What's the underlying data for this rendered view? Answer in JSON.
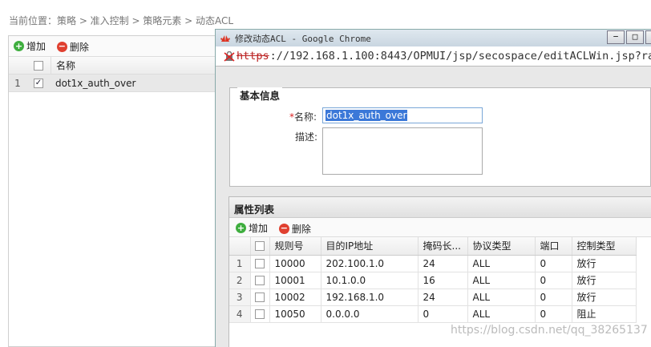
{
  "breadcrumb": {
    "text": "当前位置：策略 > 准入控制 > 策略元素 > 动态ACL"
  },
  "bg_grid": {
    "add_label": "增加",
    "delete_label": "删除",
    "header_name": "名称",
    "rows": [
      {
        "num": "1",
        "name": "dot1x_auth_over",
        "checked": true
      }
    ]
  },
  "window": {
    "title": "修改动态ACL - Google Chrome",
    "minimize": "−",
    "maximize": "□",
    "url_protocol": "https",
    "url_rest": "://192.168.1.100:8443/OPMUI/jsp/secospace/editACLWin.jsp?ra"
  },
  "basic_info": {
    "legend": "基本信息",
    "required_mark": "*",
    "name_label": "名称:",
    "name_value": "dot1x_auth_over",
    "desc_label": "描述:",
    "desc_value": ""
  },
  "attr_list": {
    "title": "属性列表",
    "add_label": "增加",
    "delete_label": "删除",
    "columns": [
      "规则号",
      "目的IP地址",
      "掩码长...",
      "协议类型",
      "端口",
      "控制类型"
    ],
    "rows": [
      {
        "num": "1",
        "rule": "10000",
        "ip": "202.100.1.0",
        "mask": "24",
        "proto": "ALL",
        "port": "0",
        "action": "放行"
      },
      {
        "num": "2",
        "rule": "10001",
        "ip": "10.1.0.0",
        "mask": "16",
        "proto": "ALL",
        "port": "0",
        "action": "放行"
      },
      {
        "num": "3",
        "rule": "10002",
        "ip": "192.168.1.0",
        "mask": "24",
        "proto": "ALL",
        "port": "0",
        "action": "放行"
      },
      {
        "num": "4",
        "rule": "10050",
        "ip": "0.0.0.0",
        "mask": "0",
        "proto": "ALL",
        "port": "0",
        "action": "阻止"
      }
    ]
  },
  "watermark": "https://blog.csdn.net/qq_38265137"
}
